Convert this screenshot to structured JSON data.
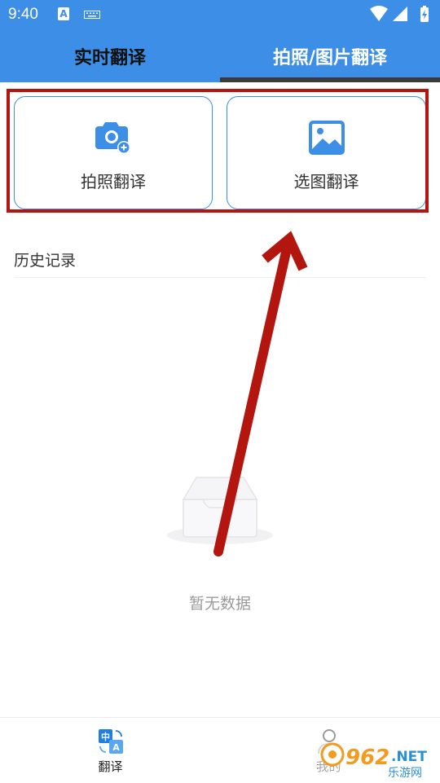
{
  "status_bar": {
    "time": "9:40",
    "a_icon": "A"
  },
  "tabs": [
    {
      "label": "实时翻译",
      "active": false
    },
    {
      "label": "拍照/图片翻译",
      "active": true
    }
  ],
  "actions": [
    {
      "label": "拍照翻译",
      "icon": "camera-plus-icon"
    },
    {
      "label": "选图翻译",
      "icon": "image-icon"
    }
  ],
  "history": {
    "title": "历史记录",
    "empty_text": "暂无数据"
  },
  "bottom_nav": [
    {
      "label": "翻译",
      "icon": "translate-icon",
      "icon_chars": [
        "中",
        "A"
      ]
    },
    {
      "label": "我的",
      "icon": "profile-icon"
    }
  ],
  "watermark": {
    "number": "962",
    "suffix": ".NET",
    "text": "乐游网"
  },
  "colors": {
    "primary": "#3d8ee6",
    "annotation_red": "#b3160f",
    "muted": "#9a9a9a"
  }
}
